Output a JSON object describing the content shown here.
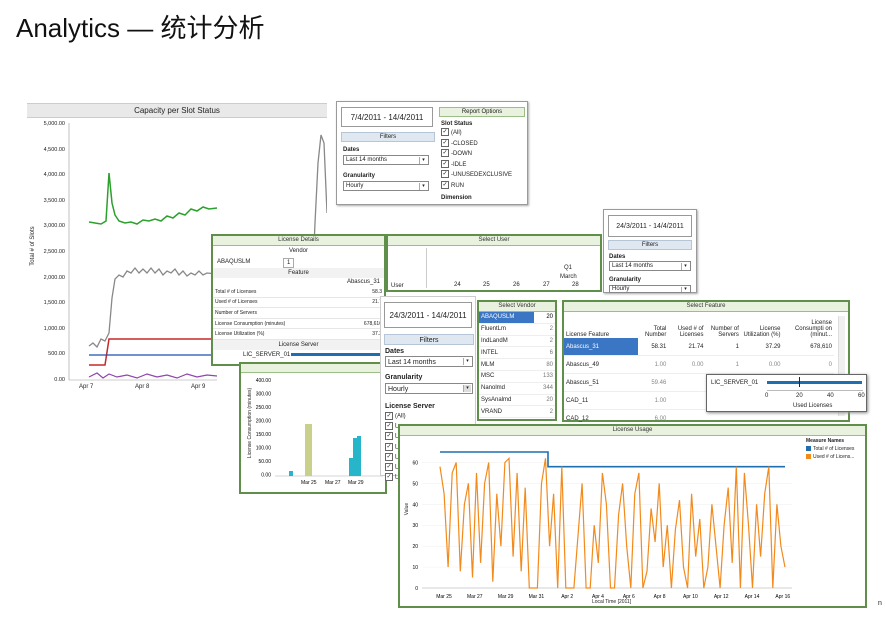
{
  "page_title": "Analytics — 统计分析",
  "capacity": {
    "title": "Capacity per Slot Status",
    "ylabel": "Total # of Slots",
    "yticks": [
      "5,000.00",
      "4,500.00",
      "4,000.00",
      "3,500.00",
      "3,000.00",
      "2,500.00",
      "2,000.00",
      "1,500.00",
      "1,000.00",
      "500.00",
      "0.00"
    ],
    "xticks": [
      "Apr 7",
      "Apr 8",
      "Apr 9"
    ]
  },
  "report_options": {
    "date_range": "7/4/2011 - 14/4/2011",
    "filters_label": "Filters",
    "dates_label": "Dates",
    "dates_value": "Last 14 months",
    "granularity_label": "Granularity",
    "granularity_value": "Hourly",
    "header": "Report Options",
    "slot_status_label": "Slot Status",
    "slot_status_items": [
      "(All)",
      "-CLOSED",
      "-DOWN",
      "-IDLE",
      "-UNUSEDEXCLUSIVE",
      "RUN"
    ],
    "dimension_label": "Dimension"
  },
  "license_details": {
    "header": "License Details",
    "vendor_label": "Vendor",
    "vendor_name": "ABAQUSLM",
    "vendor_count": "1",
    "feature_label": "Feature",
    "feature_value": "Abascus_31",
    "rows": [
      {
        "label": "Total # of Licenses",
        "value": "58.3"
      },
      {
        "label": "Used # of Licenses",
        "value": "21.7"
      },
      {
        "label": "Number of Servers",
        "value": ""
      },
      {
        "label": "License Consumption (minutes)",
        "value": "678,610"
      },
      {
        "label": "License Utilization (%)",
        "value": "37.2"
      }
    ],
    "server_label": "License Server",
    "server_name": "LIC_SERVER_01"
  },
  "select_user": {
    "header": "Select User",
    "user_label": "User",
    "quarter": "Q1",
    "month": "March",
    "days": [
      "24",
      "25",
      "26",
      "27",
      "28"
    ]
  },
  "right_date": {
    "date_range": "24/3/2011 - 14/4/2011",
    "filters_label": "Filters",
    "dates_label": "Dates",
    "dates_value": "Last 14 months",
    "granularity_label": "Granularity",
    "granularity_value": "Hourly"
  },
  "consumption_chart": {
    "ylabel": "License Consumption (minutes)",
    "yticks": [
      "400.00",
      "300.00",
      "250.00",
      "200.00",
      "150.00",
      "100.00",
      "50.00",
      "0.00"
    ],
    "xticks": [
      "Mar 25",
      "Mar 27",
      "Mar 29"
    ]
  },
  "mid_filters": {
    "date_range": "24/3/2011 - 14/4/2011",
    "filters_label": "Filters",
    "dates_label": "Dates",
    "dates_value": "Last 14 months",
    "granularity_label": "Granularity",
    "granularity_value": "Hourly",
    "license_server_label": "License Server",
    "items": [
      "(All)",
      "L",
      "L",
      "L",
      "L",
      "L",
      "L"
    ]
  },
  "select_vendor": {
    "header": "Select Vendor",
    "rows": [
      {
        "name": "ABAQUSLM",
        "count": "20",
        "selected": true
      },
      {
        "name": "FluentLm",
        "count": "2"
      },
      {
        "name": "IndLandM",
        "count": "2"
      },
      {
        "name": "INTEL",
        "count": "6"
      },
      {
        "name": "MLM",
        "count": "80"
      },
      {
        "name": "MSC",
        "count": "133"
      },
      {
        "name": "Nanolmd",
        "count": "344"
      },
      {
        "name": "SysAnalmd",
        "count": "20"
      },
      {
        "name": "VRAND",
        "count": "2"
      }
    ]
  },
  "select_feature": {
    "header": "Select Feature",
    "columns": [
      "License Feature",
      "Total Number",
      "Used # of Licenses",
      "Number of Servers",
      "License Utilization (%)",
      "License Consumpti on (minut..."
    ],
    "rows": [
      {
        "feature": "Abascus_31",
        "total": "58.31",
        "used": "21.74",
        "servers": "1",
        "util": "37.29",
        "cons": "678,610",
        "selected": true
      },
      {
        "feature": "Abascus_49",
        "total": "1.00",
        "used": "0.00",
        "servers": "1",
        "util": "0.00",
        "cons": "0"
      },
      {
        "feature": "Abascus_51",
        "total": "59.46",
        "used": "",
        "servers": "",
        "util": "",
        "cons": ""
      },
      {
        "feature": "CAD_11",
        "total": "1.00",
        "used": "",
        "servers": "",
        "util": "",
        "cons": ""
      },
      {
        "feature": "CAD_12",
        "total": "6.00",
        "used": "",
        "servers": "",
        "util": "",
        "cons": ""
      }
    ]
  },
  "used_popup": {
    "server": "LIC_SERVER_01",
    "ticks": [
      "0",
      "20",
      "40",
      "60"
    ],
    "label": "Used Licenses"
  },
  "license_usage": {
    "header": "License Usage",
    "ylabel": "Value",
    "xlabel": "Local Time [2011]",
    "yticks": [
      "60",
      "50",
      "40",
      "30",
      "20",
      "10",
      "0"
    ],
    "xticks": [
      "Mar 25",
      "Mar 27",
      "Mar 29",
      "Mar 31",
      "Apr 2",
      "Apr 4",
      "Apr 6",
      "Apr 8",
      "Apr 10",
      "Apr 12",
      "Apr 14",
      "Apr 16"
    ],
    "legend_title": "Measure Names",
    "legend": [
      {
        "name": "Total # of Licenses",
        "color": "#1f6fb0"
      },
      {
        "name": "Used # of Licens...",
        "color": "#f28a1c"
      }
    ]
  },
  "footer_fragment": "n"
}
